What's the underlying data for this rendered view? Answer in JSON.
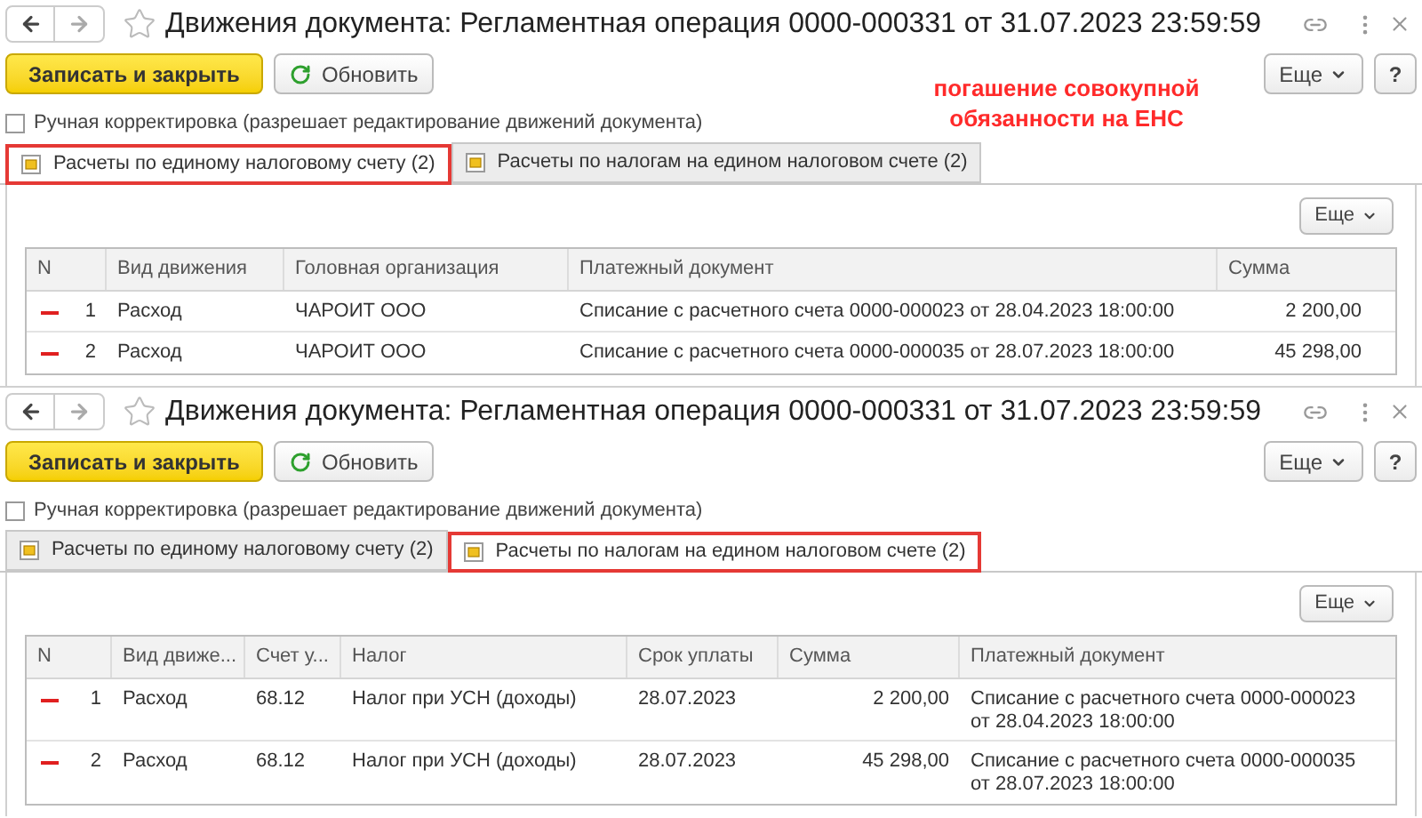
{
  "annotation": {
    "text": "погашение совокупной обязанности на ЕНС"
  },
  "windows": [
    {
      "title": "Движения документа: Регламентная операция 0000-000331 от 31.07.2023 23:59:59",
      "buttons": [
        {
          "label": "Записать и закрыть",
          "kind": "primary"
        },
        {
          "label": "Обновить",
          "kind": "refresh"
        }
      ],
      "right_buttons": [
        {
          "label": "Еще",
          "kind": "menu"
        },
        {
          "label": "?",
          "kind": "help"
        }
      ],
      "checkbox": {
        "label": "Ручная корректировка (разрешает редактирование движений документа)",
        "checked": false
      },
      "tabs": [
        {
          "label": "Расчеты по единому налоговому счету (2)",
          "selected": true,
          "highlighted": true
        },
        {
          "label": "Расчеты по налогам на едином налоговом счете (2)",
          "selected": false,
          "highlighted": false
        }
      ],
      "more_button": "Еще",
      "table": {
        "columns": [
          "N",
          "Вид движения",
          "Головная организация",
          "Платежный документ",
          "Сумма"
        ],
        "rows": [
          {
            "kind": "expense",
            "cells": [
              "1",
              "Расход",
              "ЧАРОИТ ООО",
              "Списание с расчетного счета 0000-000023 от 28.04.2023 18:00:00",
              "2 200,00"
            ]
          },
          {
            "kind": "expense",
            "cells": [
              "2",
              "Расход",
              "ЧАРОИТ ООО",
              "Списание с расчетного счета 0000-000035 от 28.07.2023 18:00:00",
              "45 298,00"
            ]
          }
        ]
      }
    },
    {
      "title": "Движения документа: Регламентная операция 0000-000331 от 31.07.2023 23:59:59",
      "buttons": [
        {
          "label": "Записать и закрыть",
          "kind": "primary"
        },
        {
          "label": "Обновить",
          "kind": "refresh"
        }
      ],
      "right_buttons": [
        {
          "label": "Еще",
          "kind": "menu"
        },
        {
          "label": "?",
          "kind": "help"
        }
      ],
      "checkbox": {
        "label": "Ручная корректировка (разрешает редактирование движений документа)",
        "checked": false
      },
      "tabs": [
        {
          "label": "Расчеты по единому налоговому счету (2)",
          "selected": false,
          "highlighted": false
        },
        {
          "label": "Расчеты по налогам на едином налоговом счете (2)",
          "selected": true,
          "highlighted": true
        }
      ],
      "more_button": "Еще",
      "table": {
        "columns": [
          "N",
          "Вид движе...",
          "Счет у...",
          "Налог",
          "Срок уплаты",
          "Сумма",
          "Платежный документ"
        ],
        "rows": [
          {
            "kind": "expense",
            "cells": [
              "1",
              "Расход",
              "68.12",
              "Налог при УСН (доходы)",
              "28.07.2023",
              "2 200,00",
              "Списание с расчетного счета 0000-000023 от 28.04.2023 18:00:00"
            ]
          },
          {
            "kind": "expense",
            "cells": [
              "2",
              "Расход",
              "68.12",
              "Налог при УСН (доходы)",
              "28.07.2023",
              "45 298,00",
              "Списание с расчетного счета 0000-000035 от 28.07.2023 18:00:00"
            ]
          }
        ]
      }
    }
  ]
}
